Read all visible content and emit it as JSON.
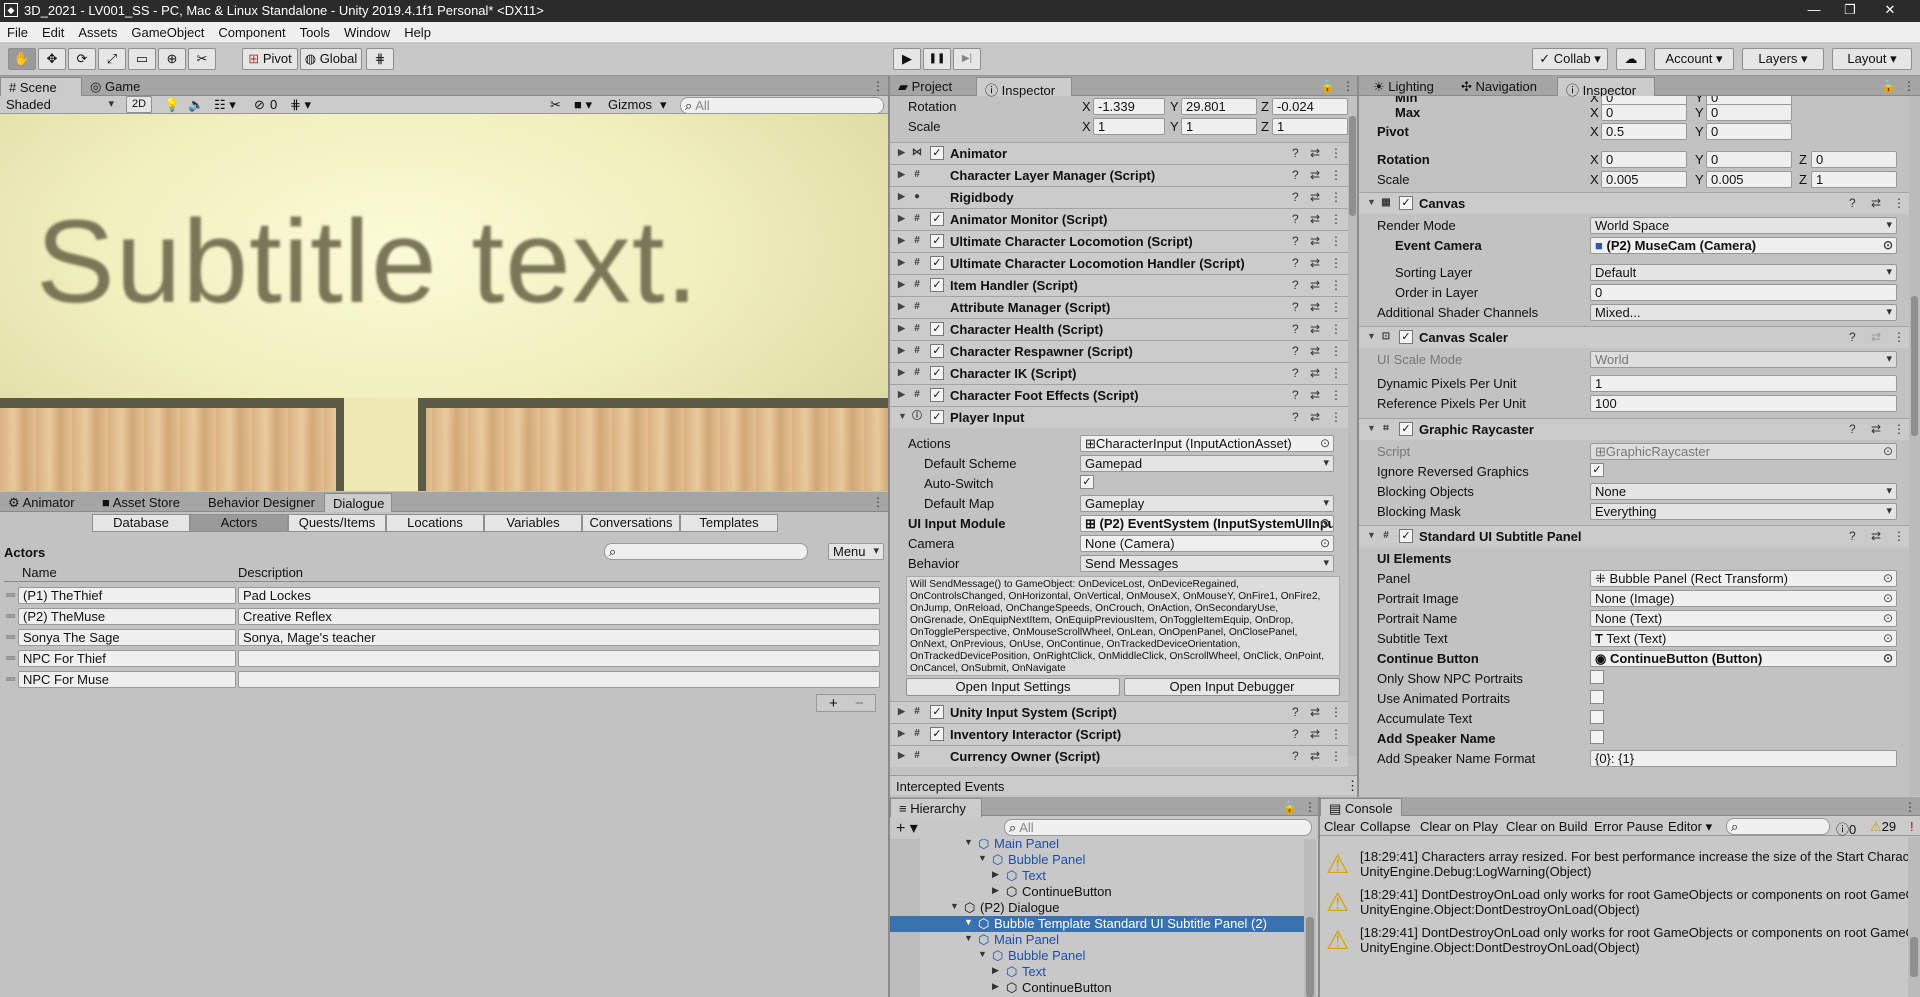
{
  "window": {
    "title": "3D_2021 - LV001_SS - PC, Mac & Linux Standalone - Unity 2019.4.1f1 Personal* <DX11>",
    "app_icon": "unity-icon",
    "min": "—",
    "max": "❐",
    "close": "✕"
  },
  "menu": [
    "File",
    "Edit",
    "Assets",
    "GameObject",
    "Component",
    "Tools",
    "Window",
    "Help"
  ],
  "toolbar": {
    "pivot": "Pivot",
    "global": "Global",
    "collab": "Collab",
    "account": "Account",
    "layers": "Layers",
    "layout": "Layout",
    "play": "▶",
    "pause": "❚❚",
    "step": "▶|"
  },
  "scene": {
    "tabs": [
      "Scene",
      "Game"
    ],
    "shading": "Shaded",
    "mode2d": "2D",
    "gizmo_count": "0",
    "gizmos": "Gizmos",
    "search_placeholder": "All",
    "subtitle": "Subtitle text."
  },
  "dialogue": {
    "tabs": [
      "Animator",
      "Asset Store",
      "Behavior Designer",
      "Dialogue"
    ],
    "subtabs": [
      "Database",
      "Actors",
      "Quests/Items",
      "Locations",
      "Variables",
      "Conversations",
      "Templates"
    ],
    "section": "Actors",
    "menu": "Menu",
    "col_name": "Name",
    "col_desc": "Description",
    "actors": [
      {
        "name": "(P1) TheThief",
        "desc": "Pad Lockes"
      },
      {
        "name": "(P2) TheMuse",
        "desc": "Creative Reflex"
      },
      {
        "name": "Sonya The Sage",
        "desc": "Sonya, Mage's teacher"
      },
      {
        "name": "NPC For Thief",
        "desc": ""
      },
      {
        "name": "NPC For Muse",
        "desc": ""
      }
    ],
    "add": "+",
    "remove": "−"
  },
  "inspector1": {
    "tabs": [
      "Project",
      "Inspector"
    ],
    "rotation": {
      "label": "Rotation",
      "x": "-1.339",
      "y": "29.801",
      "z": "-0.024"
    },
    "scale": {
      "label": "Scale",
      "x": "1",
      "y": "1",
      "z": "1"
    },
    "components": [
      {
        "name": "Animator",
        "check": true,
        "icon": "animator-icon"
      },
      {
        "name": "Character Layer Manager (Script)",
        "check": false,
        "icon": "script-icon"
      },
      {
        "name": "Rigidbody",
        "check": false,
        "icon": "rigidbody-icon"
      },
      {
        "name": "Animator Monitor (Script)",
        "check": true,
        "icon": "script-icon"
      },
      {
        "name": "Ultimate Character Locomotion (Script)",
        "check": true,
        "icon": "script-icon"
      },
      {
        "name": "Ultimate Character Locomotion Handler (Script)",
        "check": true,
        "icon": "script-icon"
      },
      {
        "name": "Item Handler (Script)",
        "check": true,
        "icon": "script-icon"
      },
      {
        "name": "Attribute Manager (Script)",
        "check": false,
        "icon": "script-icon"
      },
      {
        "name": "Character Health (Script)",
        "check": true,
        "icon": "script-icon"
      },
      {
        "name": "Character Respawner (Script)",
        "check": true,
        "icon": "script-icon"
      },
      {
        "name": "Character IK (Script)",
        "check": true,
        "icon": "script-icon"
      },
      {
        "name": "Character Foot Effects (Script)",
        "check": true,
        "icon": "script-icon"
      },
      {
        "name": "Player Input",
        "check": true,
        "icon": "input-icon"
      }
    ],
    "player_input": {
      "actions_l": "Actions",
      "actions_v": "CharacterInput (InputActionAsset)",
      "scheme_l": "Default Scheme",
      "scheme_v": "Gamepad",
      "autoswitch_l": "Auto-Switch",
      "map_l": "Default Map",
      "map_v": "Gameplay",
      "ui_l": "UI Input Module",
      "ui_v": "(P2) EventSystem (InputSystemUIInpu",
      "camera_l": "Camera",
      "camera_v": "None (Camera)",
      "behavior_l": "Behavior",
      "behavior_v": "Send Messages",
      "message": "Will SendMessage() to GameObject: OnDeviceLost, OnDeviceRegained, OnControlsChanged, OnHorizontal, OnVertical, OnMouseX, OnMouseY, OnFire1, OnFire2, OnJump, OnReload, OnChangeSpeeds, OnCrouch, OnAction, OnSecondaryUse, OnGrenade, OnEquipNextItem, OnEquipPreviousItem, OnToggleItemEquip, OnDrop, OnTogglePerspective, OnMouseScrollWheel, OnLean, OnOpenPanel, OnClosePanel, OnNext, OnPrevious, OnUse, OnContinue, OnTrackedDeviceOrientation, OnTrackedDevicePosition, OnRightClick, OnMiddleClick, OnScrollWheel, OnClick, OnPoint, OnCancel, OnSubmit, OnNavigate",
      "open_settings": "Open Input Settings",
      "open_debugger": "Open Input Debugger"
    },
    "components2": [
      {
        "name": "Unity Input System (Script)",
        "check": true
      },
      {
        "name": "Inventory Interactor (Script)",
        "check": true
      },
      {
        "name": "Currency Owner (Script)",
        "check": false
      }
    ],
    "intercepted": "Intercepted Events"
  },
  "hierarchy": {
    "tab": "Hierarchy",
    "add": "+",
    "search_placeholder": "All",
    "rows": [
      {
        "label": "Main Panel",
        "indent": 2,
        "blue": true
      },
      {
        "label": "Bubble Panel",
        "indent": 3,
        "blue": true
      },
      {
        "label": "Text",
        "indent": 4,
        "blue": true
      },
      {
        "label": "ContinueButton",
        "indent": 4,
        "blue": false
      },
      {
        "label": "(P2) Dialogue",
        "indent": 1,
        "blue": false
      },
      {
        "label": "Bubble Template Standard UI Subtitle Panel (2)",
        "indent": 2,
        "blue": false,
        "selected": true
      },
      {
        "label": "Main Panel",
        "indent": 2,
        "blue": true
      },
      {
        "label": "Bubble Panel",
        "indent": 3,
        "blue": true
      },
      {
        "label": "Text",
        "indent": 4,
        "blue": true
      },
      {
        "label": "ContinueButton",
        "indent": 4,
        "blue": false
      }
    ]
  },
  "inspector2": {
    "tabs": [
      "Lighting",
      "Navigation",
      "Inspector"
    ],
    "min": {
      "label": "Min",
      "x": "0",
      "y": "0"
    },
    "max": {
      "label": "Max",
      "x": "0",
      "y": "0"
    },
    "pivot": {
      "label": "Pivot",
      "x": "0.5",
      "y": "0"
    },
    "rotation": {
      "label": "Rotation",
      "x": "0",
      "y": "0",
      "z": "0"
    },
    "scale": {
      "label": "Scale",
      "x": "0.005",
      "y": "0.005",
      "z": "1"
    },
    "canvas": {
      "title": "Canvas",
      "render_mode_l": "Render Mode",
      "render_mode_v": "World Space",
      "event_camera_l": "Event Camera",
      "event_camera_v": "(P2) MuseCam (Camera)",
      "sorting_l": "Sorting Layer",
      "sorting_v": "Default",
      "order_l": "Order in Layer",
      "order_v": "0",
      "shader_l": "Additional Shader Channels",
      "shader_v": "Mixed..."
    },
    "scaler": {
      "title": "Canvas Scaler",
      "mode_l": "UI Scale Mode",
      "mode_v": "World",
      "dyn_l": "Dynamic Pixels Per Unit",
      "dyn_v": "1",
      "ref_l": "Reference Pixels Per Unit",
      "ref_v": "100"
    },
    "raycaster": {
      "title": "Graphic Raycaster",
      "script_l": "Script",
      "script_v": "GraphicRaycaster",
      "ignore_l": "Ignore Reversed Graphics",
      "block_obj_l": "Blocking Objects",
      "block_obj_v": "None",
      "block_mask_l": "Blocking Mask",
      "block_mask_v": "Everything"
    },
    "subtitle": {
      "title": "Standard UI Subtitle Panel",
      "elements_l": "UI Elements",
      "panel_l": "Panel",
      "panel_v": "Bubble Panel (Rect Transform)",
      "portrait_img_l": "Portrait Image",
      "portrait_img_v": "None (Image)",
      "portrait_name_l": "Portrait Name",
      "portrait_name_v": "None (Text)",
      "subtitle_text_l": "Subtitle Text",
      "subtitle_text_v": "Text (Text)",
      "continue_l": "Continue Button",
      "continue_v": "ContinueButton (Button)",
      "npc_l": "Only Show NPC Portraits",
      "anim_l": "Use Animated Portraits",
      "accum_l": "Accumulate Text",
      "speaker_l": "Add Speaker Name",
      "format_l": "Add Speaker Name Format",
      "format_v": "{0}: {1}"
    }
  },
  "console": {
    "tab": "Console",
    "buttons": [
      "Clear",
      "Collapse",
      "Clear on Play",
      "Clear on Build",
      "Error Pause",
      "Editor"
    ],
    "info_count": "0",
    "warn_count": "29",
    "messages": [
      {
        "line1": "[18:29:41] Characters array resized. For best performance increase the size of the Start Character (",
        "line2": "UnityEngine.Debug:LogWarning(Object)"
      },
      {
        "line1": "[18:29:41] DontDestroyOnLoad only works for root GameObjects or components on root GameObje",
        "line2": "UnityEngine.Object:DontDestroyOnLoad(Object)"
      },
      {
        "line1": "[18:29:41] DontDestroyOnLoad only works for root GameObjects or components on root GameObje",
        "line2": "UnityEngine.Object:DontDestroyOnLoad(Object)"
      }
    ]
  }
}
